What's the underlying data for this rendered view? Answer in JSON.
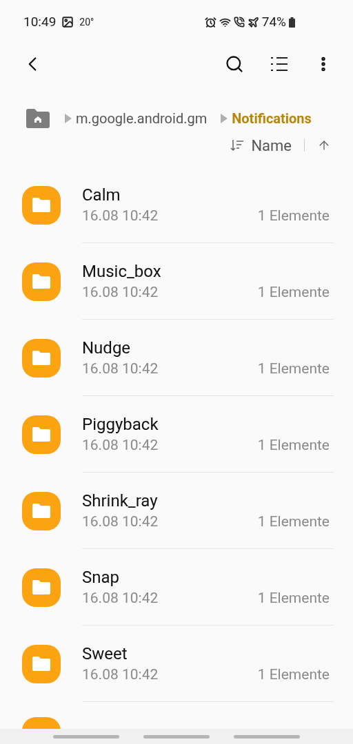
{
  "status_bar": {
    "time": "10:49",
    "temperature": "20°",
    "battery": "74%"
  },
  "breadcrumb": [
    {
      "label": "m.google.android.gm",
      "selected": false
    },
    {
      "label": "Notifications",
      "selected": true
    }
  ],
  "sort": {
    "label": "Name"
  },
  "folders": [
    {
      "name": "Calm",
      "date": "16.08 10:42",
      "count": "1 Elemente"
    },
    {
      "name": "Music_box",
      "date": "16.08 10:42",
      "count": "1 Elemente"
    },
    {
      "name": "Nudge",
      "date": "16.08 10:42",
      "count": "1 Elemente"
    },
    {
      "name": "Piggyback",
      "date": "16.08 10:42",
      "count": "1 Elemente"
    },
    {
      "name": "Shrink_ray",
      "date": "16.08 10:42",
      "count": "1 Elemente"
    },
    {
      "name": "Snap",
      "date": "16.08 10:42",
      "count": "1 Elemente"
    },
    {
      "name": "Sweet",
      "date": "16.08 10:42",
      "count": "1 Elemente"
    }
  ]
}
